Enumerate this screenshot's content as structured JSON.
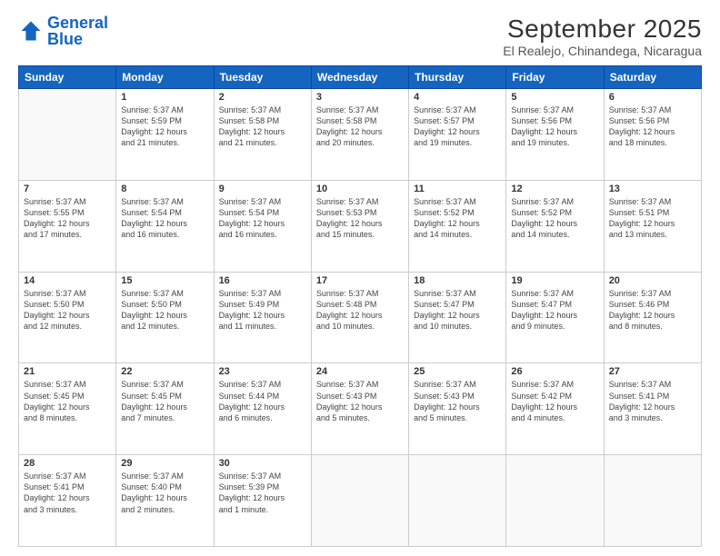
{
  "header": {
    "logo_general": "General",
    "logo_blue": "Blue",
    "month": "September 2025",
    "location": "El Realejo, Chinandega, Nicaragua"
  },
  "weekdays": [
    "Sunday",
    "Monday",
    "Tuesday",
    "Wednesday",
    "Thursday",
    "Friday",
    "Saturday"
  ],
  "weeks": [
    [
      {
        "day": "",
        "text": ""
      },
      {
        "day": "1",
        "text": "Sunrise: 5:37 AM\nSunset: 5:59 PM\nDaylight: 12 hours\nand 21 minutes."
      },
      {
        "day": "2",
        "text": "Sunrise: 5:37 AM\nSunset: 5:58 PM\nDaylight: 12 hours\nand 21 minutes."
      },
      {
        "day": "3",
        "text": "Sunrise: 5:37 AM\nSunset: 5:58 PM\nDaylight: 12 hours\nand 20 minutes."
      },
      {
        "day": "4",
        "text": "Sunrise: 5:37 AM\nSunset: 5:57 PM\nDaylight: 12 hours\nand 19 minutes."
      },
      {
        "day": "5",
        "text": "Sunrise: 5:37 AM\nSunset: 5:56 PM\nDaylight: 12 hours\nand 19 minutes."
      },
      {
        "day": "6",
        "text": "Sunrise: 5:37 AM\nSunset: 5:56 PM\nDaylight: 12 hours\nand 18 minutes."
      }
    ],
    [
      {
        "day": "7",
        "text": "Sunrise: 5:37 AM\nSunset: 5:55 PM\nDaylight: 12 hours\nand 17 minutes."
      },
      {
        "day": "8",
        "text": "Sunrise: 5:37 AM\nSunset: 5:54 PM\nDaylight: 12 hours\nand 16 minutes."
      },
      {
        "day": "9",
        "text": "Sunrise: 5:37 AM\nSunset: 5:54 PM\nDaylight: 12 hours\nand 16 minutes."
      },
      {
        "day": "10",
        "text": "Sunrise: 5:37 AM\nSunset: 5:53 PM\nDaylight: 12 hours\nand 15 minutes."
      },
      {
        "day": "11",
        "text": "Sunrise: 5:37 AM\nSunset: 5:52 PM\nDaylight: 12 hours\nand 14 minutes."
      },
      {
        "day": "12",
        "text": "Sunrise: 5:37 AM\nSunset: 5:52 PM\nDaylight: 12 hours\nand 14 minutes."
      },
      {
        "day": "13",
        "text": "Sunrise: 5:37 AM\nSunset: 5:51 PM\nDaylight: 12 hours\nand 13 minutes."
      }
    ],
    [
      {
        "day": "14",
        "text": "Sunrise: 5:37 AM\nSunset: 5:50 PM\nDaylight: 12 hours\nand 12 minutes."
      },
      {
        "day": "15",
        "text": "Sunrise: 5:37 AM\nSunset: 5:50 PM\nDaylight: 12 hours\nand 12 minutes."
      },
      {
        "day": "16",
        "text": "Sunrise: 5:37 AM\nSunset: 5:49 PM\nDaylight: 12 hours\nand 11 minutes."
      },
      {
        "day": "17",
        "text": "Sunrise: 5:37 AM\nSunset: 5:48 PM\nDaylight: 12 hours\nand 10 minutes."
      },
      {
        "day": "18",
        "text": "Sunrise: 5:37 AM\nSunset: 5:47 PM\nDaylight: 12 hours\nand 10 minutes."
      },
      {
        "day": "19",
        "text": "Sunrise: 5:37 AM\nSunset: 5:47 PM\nDaylight: 12 hours\nand 9 minutes."
      },
      {
        "day": "20",
        "text": "Sunrise: 5:37 AM\nSunset: 5:46 PM\nDaylight: 12 hours\nand 8 minutes."
      }
    ],
    [
      {
        "day": "21",
        "text": "Sunrise: 5:37 AM\nSunset: 5:45 PM\nDaylight: 12 hours\nand 8 minutes."
      },
      {
        "day": "22",
        "text": "Sunrise: 5:37 AM\nSunset: 5:45 PM\nDaylight: 12 hours\nand 7 minutes."
      },
      {
        "day": "23",
        "text": "Sunrise: 5:37 AM\nSunset: 5:44 PM\nDaylight: 12 hours\nand 6 minutes."
      },
      {
        "day": "24",
        "text": "Sunrise: 5:37 AM\nSunset: 5:43 PM\nDaylight: 12 hours\nand 5 minutes."
      },
      {
        "day": "25",
        "text": "Sunrise: 5:37 AM\nSunset: 5:43 PM\nDaylight: 12 hours\nand 5 minutes."
      },
      {
        "day": "26",
        "text": "Sunrise: 5:37 AM\nSunset: 5:42 PM\nDaylight: 12 hours\nand 4 minutes."
      },
      {
        "day": "27",
        "text": "Sunrise: 5:37 AM\nSunset: 5:41 PM\nDaylight: 12 hours\nand 3 minutes."
      }
    ],
    [
      {
        "day": "28",
        "text": "Sunrise: 5:37 AM\nSunset: 5:41 PM\nDaylight: 12 hours\nand 3 minutes."
      },
      {
        "day": "29",
        "text": "Sunrise: 5:37 AM\nSunset: 5:40 PM\nDaylight: 12 hours\nand 2 minutes."
      },
      {
        "day": "30",
        "text": "Sunrise: 5:37 AM\nSunset: 5:39 PM\nDaylight: 12 hours\nand 1 minute."
      },
      {
        "day": "",
        "text": ""
      },
      {
        "day": "",
        "text": ""
      },
      {
        "day": "",
        "text": ""
      },
      {
        "day": "",
        "text": ""
      }
    ]
  ]
}
